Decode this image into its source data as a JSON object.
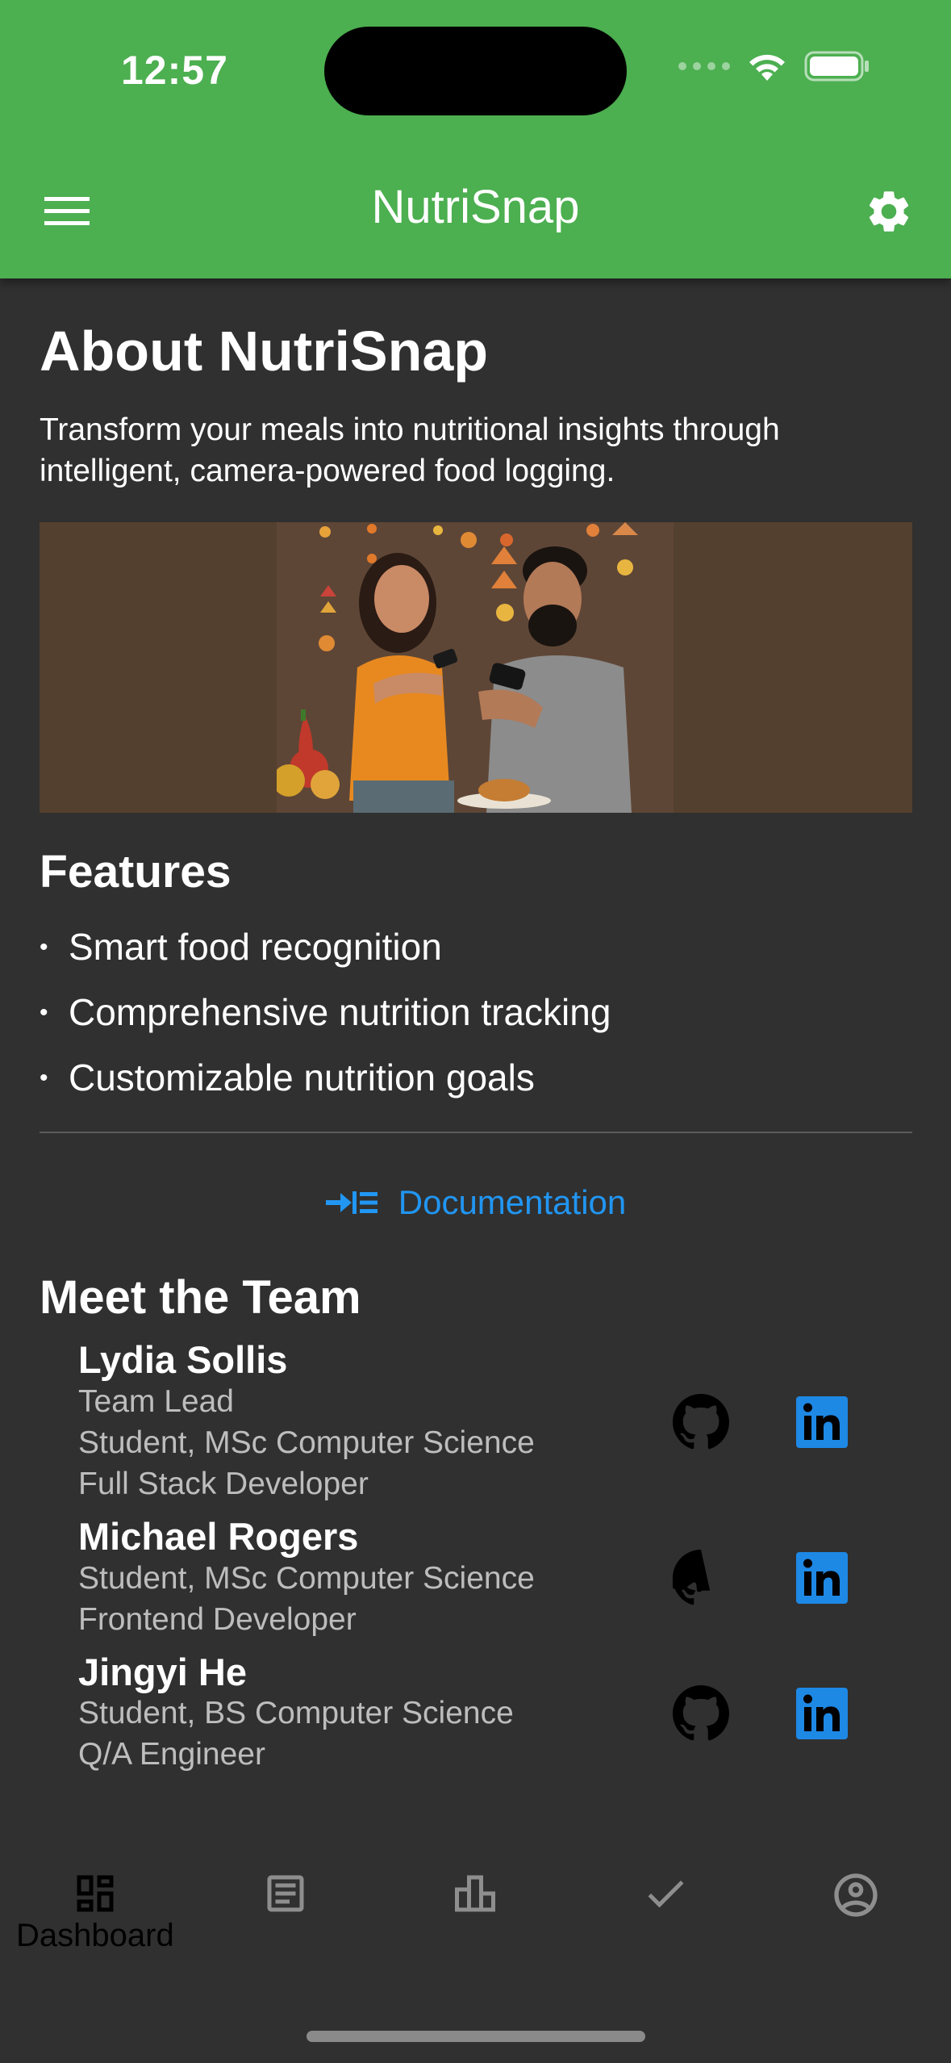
{
  "status_bar": {
    "time": "12:57"
  },
  "app_bar": {
    "title": "NutriSnap",
    "menu_icon": "hamburger-menu-icon",
    "settings_icon": "gear-icon"
  },
  "about": {
    "title": "About NutriSnap",
    "description": "Transform your meals into nutritional insights through intelligent, camera-powered food logging."
  },
  "features": {
    "title": "Features",
    "items": [
      "Smart food recognition",
      "Comprehensive nutrition tracking",
      "Customizable nutrition goals"
    ]
  },
  "documentation": {
    "label": "Documentation",
    "icon": "arrow-into-list-icon"
  },
  "team": {
    "title": "Meet the Team",
    "members": [
      {
        "name": "Lydia Sollis",
        "lines": [
          "Team Lead",
          "Student, MSc Computer Science",
          "Full Stack Developer"
        ]
      },
      {
        "name": "Michael Rogers",
        "lines": [
          "Student, MSc Computer Science",
          "Frontend Developer"
        ]
      },
      {
        "name": "Jingyi He",
        "lines": [
          "Student, BS Computer Science",
          "Q/A Engineer"
        ]
      }
    ]
  },
  "bottom_nav": {
    "items": [
      {
        "label": "Dashboard",
        "icon": "dashboard-icon",
        "active": true
      },
      {
        "label": "",
        "icon": "log-icon",
        "active": false
      },
      {
        "label": "",
        "icon": "bar-chart-icon",
        "active": false
      },
      {
        "label": "",
        "icon": "check-icon",
        "active": false
      },
      {
        "label": "",
        "icon": "profile-icon",
        "active": false
      }
    ]
  },
  "colors": {
    "primary": "#4caf50",
    "background": "#303030",
    "link": "#2196f3",
    "linkedin": "#1e88e5",
    "secondary_text": "#bdbdbd"
  }
}
